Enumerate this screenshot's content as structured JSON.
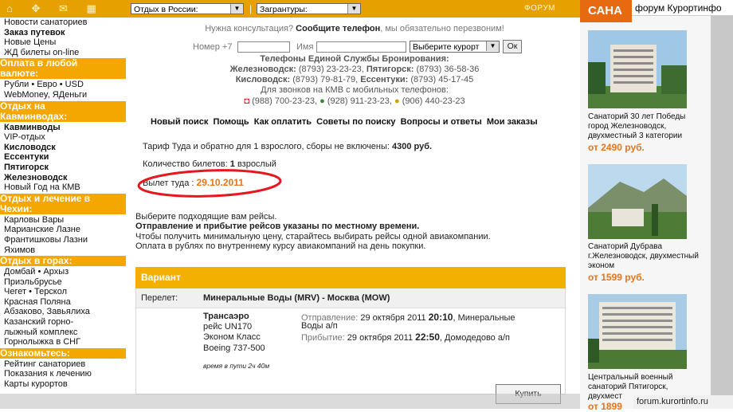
{
  "top": {
    "region_select": "Отдых в России:",
    "abroad_select": "Загрантуры:",
    "forum": "ФОРУМ"
  },
  "sidebar": {
    "group1": [
      "Новости санаториев",
      "Заказ путевок",
      "Новые Цены",
      "ЖД билеты on-line"
    ],
    "hdr_pay": [
      "Оплата в любой",
      "валюте:"
    ],
    "pay": [
      "Рубли • Евро • USD",
      "WebMoney, ЯДеньги"
    ],
    "hdr_kmv": [
      "Отдых на",
      "Кавминводах:"
    ],
    "kmv": [
      "Кавминводы",
      "VIP-отдых",
      "Кисловодск",
      "Ессентуки",
      "Пятигорск",
      "Железноводск",
      "Новый Год на КМВ"
    ],
    "hdr_czech": [
      "Отдых и лечение в",
      "Чехии:"
    ],
    "czech": [
      "Карловы Вары",
      "Марианские Лазне",
      "Франтишковы Лазни",
      "Яхимов"
    ],
    "hdr_mount": "Отдых в горах:",
    "mount": [
      "Домбай • Архыз",
      "Приэльбрусье",
      "Чегет • Терскол",
      "Красная Поляна",
      "Абзаково, Завьялиха",
      "Казанский горно-",
      "лыжный комплекс",
      "Горнолыжка в СНГ"
    ],
    "hdr_info": "Ознакомьтесь:",
    "info": [
      "Рейтинг санаториев",
      "Показания к лечению",
      "Карты курортов"
    ]
  },
  "consult": {
    "need": "Нужна консультация?",
    "tell": "Сообщите телефон",
    "callback": ", мы обязательно перезвоним!",
    "phone_label": "Номер +7",
    "name_label": "Имя",
    "resort_select": "Выберите курорт",
    "ok": "Ок"
  },
  "phones": {
    "title": "Телефоны Единой Службы Бронирования:",
    "zh_city": "Железноводск:",
    "zh_num": "(8793) 23-23-23,",
    "pt_city": "Пятигорск:",
    "pt_num": "(8793) 36-58-36",
    "ki_city": "Кисловодск:",
    "ki_num": "(8793) 79-81-79,",
    "es_city": "Ессентуки:",
    "es_num": "(8793) 45-17-45",
    "mobile_title": "Для звонков на КМВ с мобильных телефонов:",
    "m1": "(988) 700-23-23,",
    "m2": "(928) 911-23-23,",
    "m3": "(906) 440-23-23"
  },
  "nav": [
    "Новый поиск",
    "Помощь",
    "Как оплатить",
    "Советы по поиску",
    "Вопросы и ответы",
    "Мои заказы"
  ],
  "booking": {
    "tariff": "Тариф Туда и обратно для 1 взрослого, сборы не включены:",
    "tariff_price": "4300 руб.",
    "tickets_label": "Количество билетов:",
    "tickets_num": "1",
    "tickets_type": "взрослый",
    "departure_label": "Вылет туда :",
    "departure_date": "29.10.2011"
  },
  "info_text": {
    "l1": "Выберите подходящие вам рейсы.",
    "l2": "Отправление и прибытие рейсов указаны по местному времени.",
    "l3": "Чтобы получить минимальную цену, старайтесь выбирать рейсы одной авиакомпании.",
    "l4": "Оплата в рублях по внутреннему курсу авиакомпаний на день покупки."
  },
  "variant": {
    "title": "Вариант",
    "flight_label": "Перелет:",
    "route": "Минеральные Воды (MRV) - Москва (MOW)",
    "airline": "Трансаэро",
    "flight_no": "рейс  UN170",
    "class": "Эконом Класс",
    "aircraft": "Boeing 737-500",
    "duration": "время в пути  2ч 40м",
    "dep_label": "Отправление:",
    "dep_date": "29 октября 2011",
    "dep_time": "20:10",
    "dep_place": ", Минеральные",
    "dep_place2": "Воды а/п",
    "arr_label": "Прибытие:",
    "arr_date": "29 октября 2011",
    "arr_time": "22:50",
    "arr_place": ", Домодедово а/п",
    "buy": "Купить"
  },
  "right": {
    "sanat": "САНА",
    "forum_tab": "форум Курортинфо",
    "hotel1": "Санаторий 30 лет Победы город Железноводск, двухместный 3 категории",
    "price1": "от 2490 руб.",
    "hotel2": "Санаторий Дубрава г.Железноводск, двухместный эконом",
    "price2": "от 1599 руб.",
    "hotel3": "Центральный военный санаторий Пятигорск, двухмест",
    "price3": "от 1899",
    "url": "forum.kurortinfo.ru"
  },
  "colors": {
    "accent": "#f3a700",
    "price": "#e8741c",
    "highlight_circle": "#e8161e"
  }
}
